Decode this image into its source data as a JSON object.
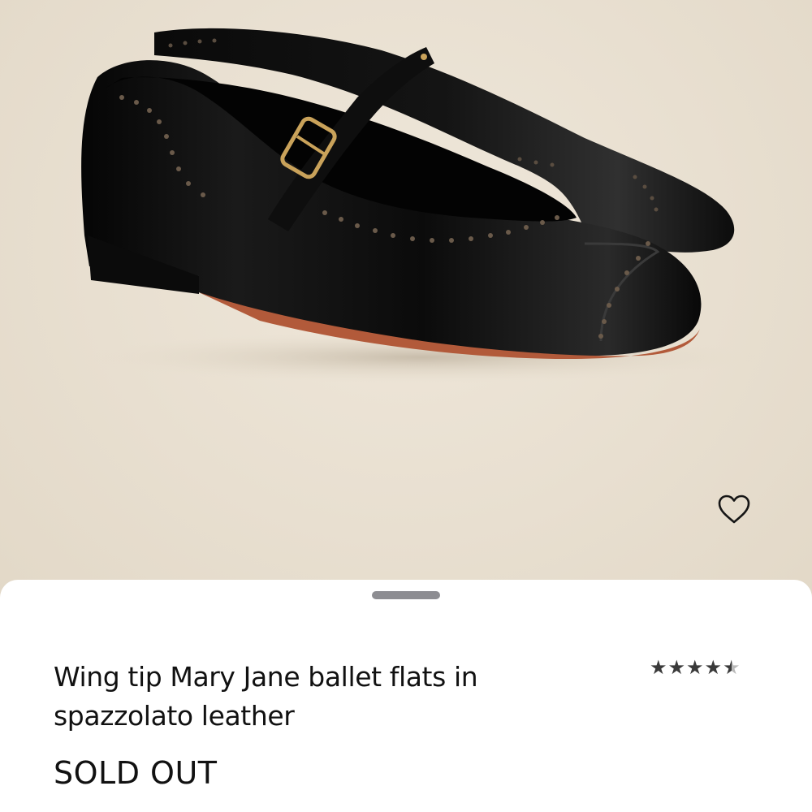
{
  "product": {
    "title": "Wing tip Mary Jane ballet flats in spazzolato leather",
    "status": "SOLD OUT",
    "rating": 4.5,
    "rating_max": 5
  },
  "icons": {
    "favorite": "heart-outline-icon",
    "star_full": "★",
    "star_half": "★"
  },
  "colors": {
    "background": "#e9e0d1",
    "shoe_leather": "#101010",
    "hardware": "#c9a25a",
    "sole_edge": "#b25a3a",
    "text": "#111111"
  }
}
